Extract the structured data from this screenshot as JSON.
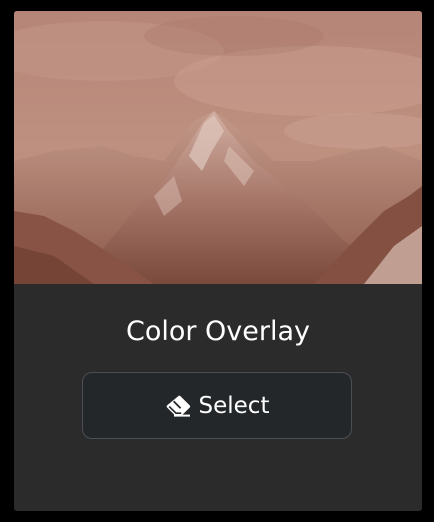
{
  "card": {
    "title": "Color Overlay",
    "preview_icon": "mountain-landscape-image",
    "overlay_color": "#b46e5a"
  },
  "select_button": {
    "label": "Select",
    "icon": "eraser-icon"
  },
  "colors": {
    "page_background": "#000000",
    "card_background": "#2b2b2b",
    "button_background": "#24272a",
    "button_border": "#4b4f53",
    "text": "#ffffff"
  }
}
